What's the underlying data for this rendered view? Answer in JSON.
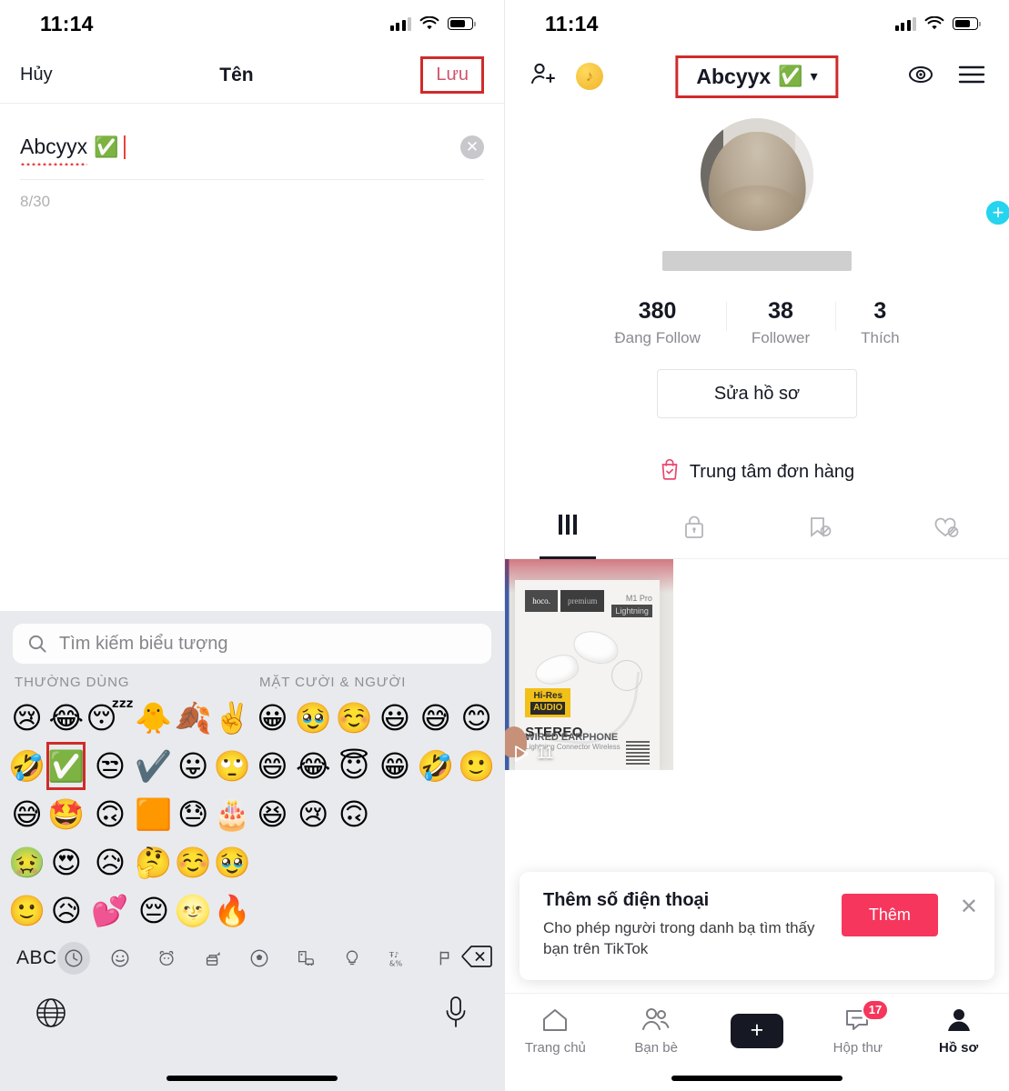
{
  "left": {
    "status": {
      "time": "11:14"
    },
    "nav": {
      "cancel": "Hủy",
      "title": "Tên",
      "save": "Lưu"
    },
    "field": {
      "value": "Abcyyx",
      "emoji": "✅",
      "clear_icon": "✕",
      "counter": "8/30"
    },
    "keyboard": {
      "search_placeholder": "Tìm kiếm biểu tượng",
      "categories": [
        {
          "title": "THƯỜNG DÙNG",
          "emojis": [
            "😢",
            "😂",
            "😴",
            "🐥",
            "🍂",
            "✌️",
            "🤣",
            "✅",
            "😒",
            "✔️",
            "😛",
            "🙄",
            "😅",
            "🤩",
            "🙃",
            "🟧",
            "😓",
            "🎂",
            "🤢",
            "😍",
            "😥",
            "🤔",
            "☺️",
            "🥹",
            "🙂",
            "😥",
            "💕",
            "😔",
            "🌝",
            "🔥"
          ],
          "highlight_index": 7
        },
        {
          "title": "MẶT CƯỜI & NGƯỜI",
          "emojis": [
            "😀",
            "🥹",
            "☺️",
            "😃",
            "😅",
            "😊",
            "😄",
            "😂",
            "😇",
            "😁",
            "🤣",
            "🙂",
            "😆",
            "😢",
            "🙃"
          ]
        }
      ],
      "abc_label": "ABC",
      "category_icons": [
        "clock-icon",
        "smiley-icon",
        "animal-icon",
        "food-icon",
        "activity-icon",
        "travel-icon",
        "objects-icon",
        "symbols-icon",
        "flag-icon"
      ],
      "delete_icon": "delete-icon",
      "globe_icon": "globe-icon",
      "mic_icon": "microphone-icon"
    }
  },
  "right": {
    "status": {
      "time": "11:14"
    },
    "nav": {
      "add_friend_icon": "add-person-icon",
      "coin_icon": "tiktok-coin-icon",
      "title": "Abcyyx",
      "title_emoji": "✅",
      "chevron": "▾",
      "eye_icon": "eye-icon",
      "menu_icon": "hamburger-menu-icon"
    },
    "avatar": {
      "plus_label": "+"
    },
    "stats": [
      {
        "value": "380",
        "label": "Đang Follow"
      },
      {
        "value": "38",
        "label": "Follower"
      },
      {
        "value": "3",
        "label": "Thích"
      }
    ],
    "edit_profile": "Sửa hồ sơ",
    "order_center": {
      "label": "Trung tâm đơn hàng",
      "icon": "shopping-bag-icon"
    },
    "tabs": [
      {
        "icon": "grid-posts-icon",
        "active": true
      },
      {
        "icon": "lock-private-icon",
        "active": false
      },
      {
        "icon": "bookmark-hidden-icon",
        "active": false
      },
      {
        "icon": "heart-hidden-icon",
        "active": false
      }
    ],
    "video": {
      "play_count": "11",
      "play_icon": "play-icon",
      "brand": "hoco.",
      "brand_sub": "premium",
      "model": "M1 Pro",
      "model_sub": "Lightning",
      "badge_top": "Hi-Res",
      "badge_bottom": "AUDIO",
      "title": "STEREO",
      "subtitle": "WIRED EARPHONE",
      "subtitle_small": "Lightning Connector Wireless"
    },
    "banner": {
      "title": "Thêm số điện thoại",
      "subtitle": "Cho phép người trong danh bạ tìm thấy bạn trên TikTok",
      "button": "Thêm",
      "close_icon": "✕"
    },
    "tabbar": [
      {
        "label": "Trang chủ",
        "icon": "home-icon",
        "active": false,
        "badge": ""
      },
      {
        "label": "Bạn bè",
        "icon": "friends-icon",
        "active": false,
        "badge": ""
      },
      {
        "label": "",
        "icon": "create-icon",
        "active": false,
        "badge": ""
      },
      {
        "label": "Hộp thư",
        "icon": "inbox-icon",
        "active": false,
        "badge": "17"
      },
      {
        "label": "Hồ sơ",
        "icon": "profile-icon",
        "active": true,
        "badge": ""
      }
    ]
  },
  "colors": {
    "highlight_red": "#d02b2b",
    "tiktok_pink": "#f6365c",
    "accent_cyan": "#25d4ef"
  }
}
